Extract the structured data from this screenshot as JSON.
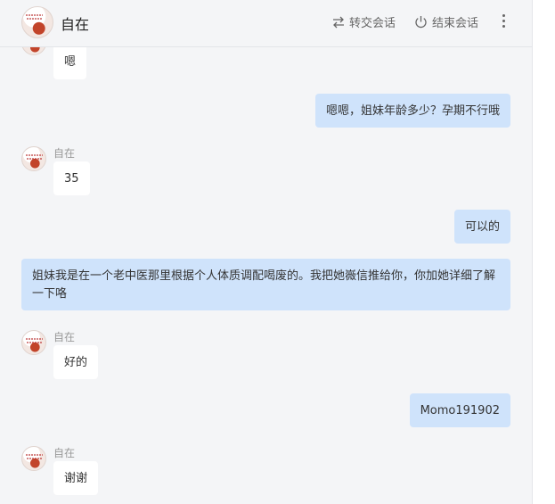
{
  "header": {
    "title": "自在",
    "transfer_label": "转交会话",
    "end_label": "结束会话"
  },
  "messages": [
    {
      "side": "in",
      "sender": "",
      "text": "嗯"
    },
    {
      "side": "out",
      "text": "嗯嗯，姐妹年龄多少？孕期不行哦"
    },
    {
      "side": "in",
      "sender": "自在",
      "text": "35"
    },
    {
      "side": "out",
      "text": "可以的"
    },
    {
      "side": "out",
      "text": "姐妹我是在一个老中医那里根据个人体质调配喝废的。我把她嶶信推给你，你加她详细了解一下咯"
    },
    {
      "side": "in",
      "sender": "自在",
      "text": "好的"
    },
    {
      "side": "out",
      "text": "Momo191902"
    },
    {
      "side": "in",
      "sender": "自在",
      "text": "谢谢"
    }
  ]
}
